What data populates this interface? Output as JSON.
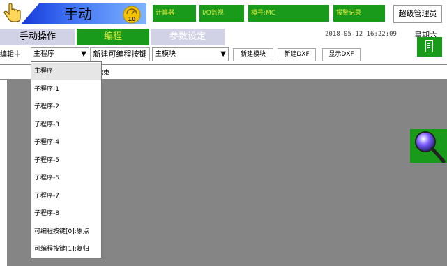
{
  "header": {
    "mode_label": "手动",
    "speed": "10",
    "calc_button": "计算器",
    "io_button": "I/O监视",
    "model_button": "模号:MC",
    "alarm_button": "报警记录",
    "admin_button": "超级管理员"
  },
  "tabs": {
    "manual": "手动操作",
    "program": "编程",
    "params": "参数设定"
  },
  "status": {
    "datetime": "2018-05-12  16:22:09",
    "weekday": "星期六"
  },
  "toolbar": {
    "editing_label": "编辑中",
    "program_select": "主程序",
    "new_key_button": "新建可编程按键",
    "module_select": "主模块",
    "new_module_button": "新建模块",
    "new_dxf_button": "新建DXF",
    "show_dxf_button": "显示DXF"
  },
  "content": {
    "row_text": "组结束"
  },
  "dropdown": {
    "items": [
      "主程序",
      "子程序-1",
      "子程序-2",
      "子程序-3",
      "子程序-4",
      "子程序-5",
      "子程序-6",
      "子程序-7",
      "子程序-8",
      "可编程按键[0]:原点",
      "可编程按键[1]:复归"
    ],
    "selected_index": 0
  },
  "icons": {
    "hand": "hand-pointer-icon",
    "speed": "speed-gauge-icon",
    "magnifier": "magnifier-icon",
    "document": "document-icon"
  },
  "colors": {
    "accent_green": "#1a9a1a",
    "header_blue": "#1e3fe0",
    "tab_lavender": "#d2d2e6",
    "content_gray": "#858585"
  }
}
